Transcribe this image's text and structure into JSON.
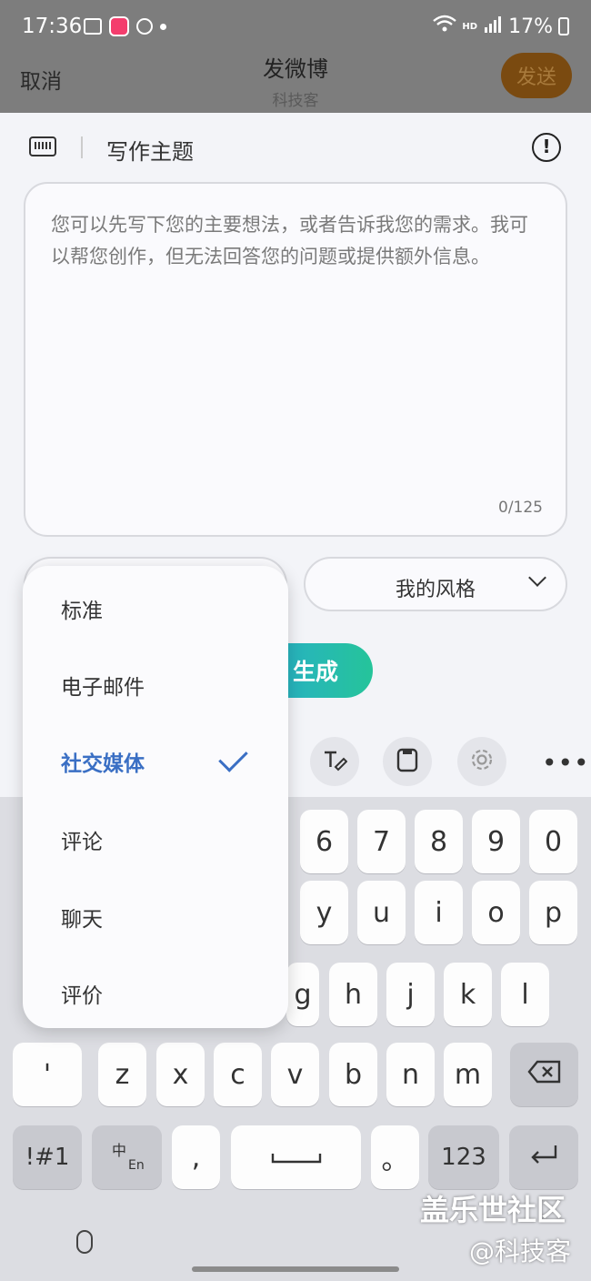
{
  "status_bar": {
    "time": "17:36",
    "network": "HD",
    "battery": "17%"
  },
  "header": {
    "cancel": "取消",
    "title": "发微博",
    "subtitle": "科技客",
    "send": "发送"
  },
  "topic": {
    "label": "写作主题"
  },
  "textbox": {
    "placeholder": "您可以先写下您的主要想法，或者告诉我您的需求。我可以帮您创作，但无法回答您的问题或提供额外信息。",
    "counter": "0/125"
  },
  "style_select": {
    "value": "我的风格"
  },
  "generate_button": "生成",
  "dropdown": {
    "options": [
      "标准",
      "电子邮件",
      "社交媒体",
      "评论",
      "聊天",
      "评价"
    ],
    "selected": "社交媒体"
  },
  "keyboard": {
    "row1": [
      "6",
      "7",
      "8",
      "9",
      "0"
    ],
    "row2": [
      "y",
      "u",
      "i",
      "o",
      "p"
    ],
    "row3": [
      "g",
      "h",
      "j",
      "k",
      "l"
    ],
    "row4": [
      "'",
      "z",
      "x",
      "c",
      "v",
      "b",
      "n",
      "m"
    ],
    "sym": "!#1",
    "lang_top": "中",
    "lang_bottom": "En",
    "comma": ",",
    "period": "。",
    "num": "123"
  },
  "watermark": {
    "line1": "盖乐世社区",
    "line2": "@科技客"
  }
}
